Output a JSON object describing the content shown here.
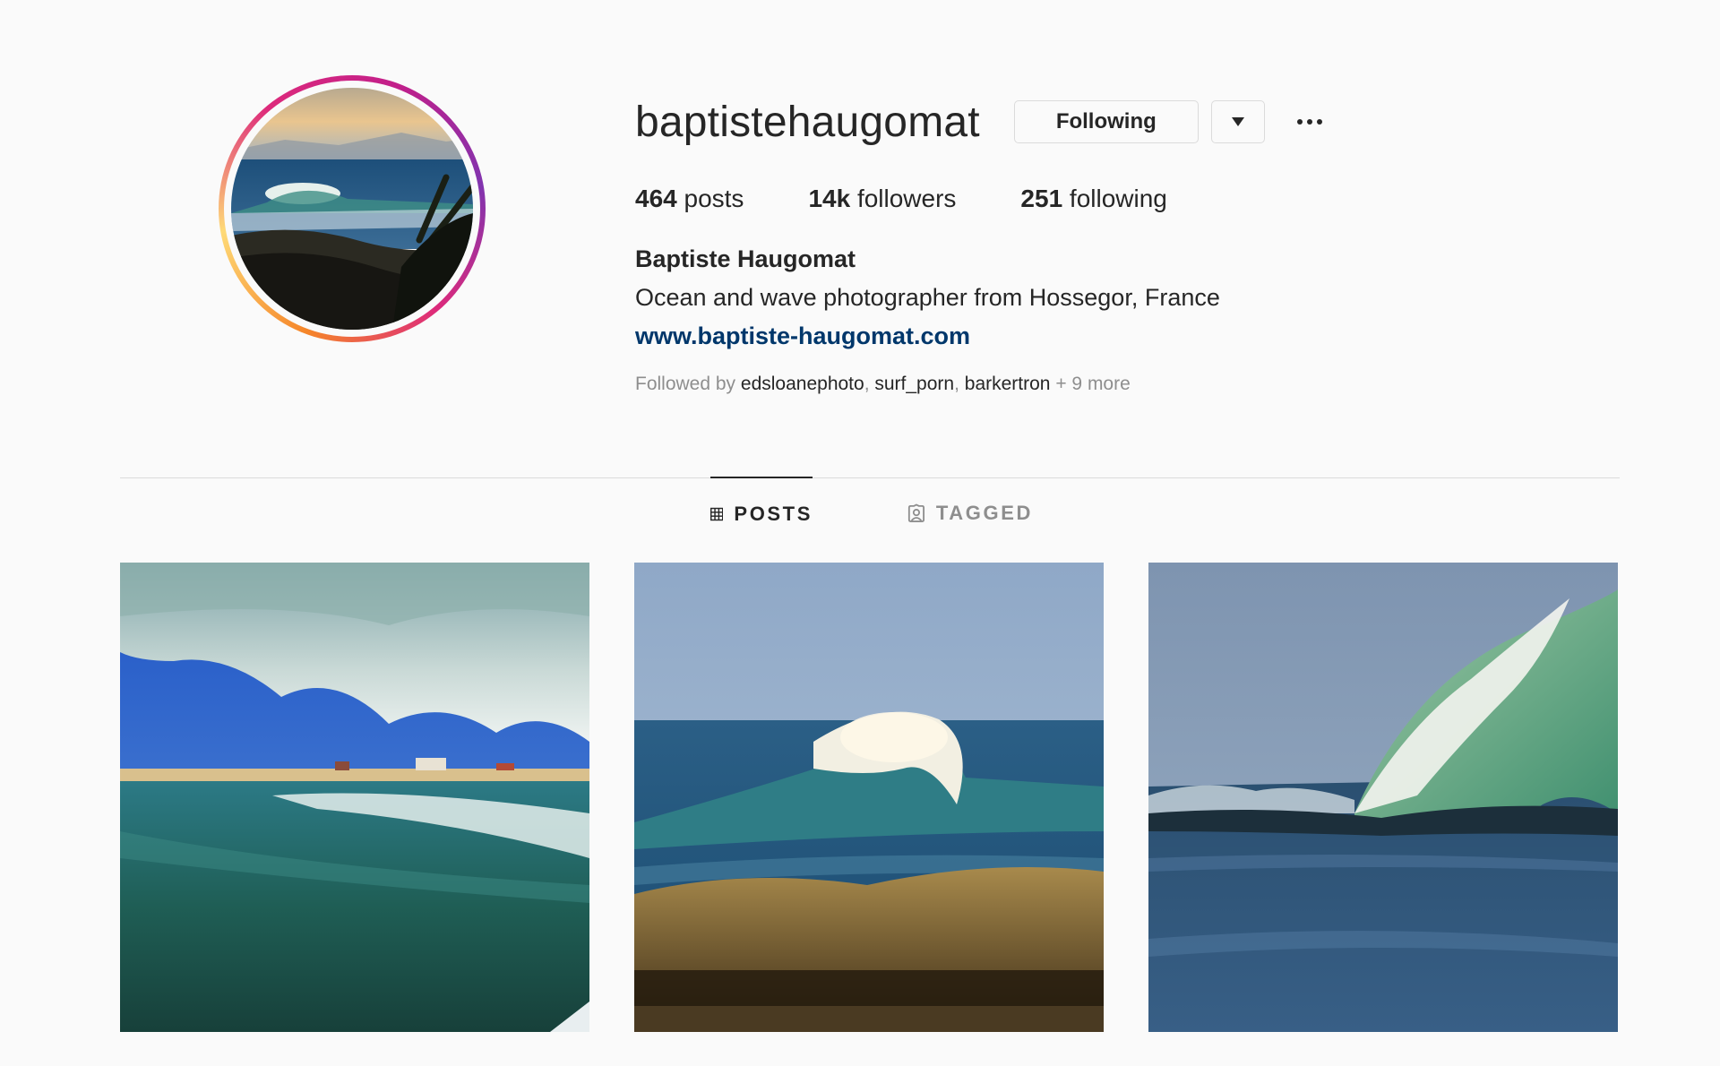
{
  "profile": {
    "username": "baptistehaugomat",
    "following_button": "Following",
    "stats": {
      "posts_count": "464",
      "posts_label": "posts",
      "followers_count": "14k",
      "followers_label": "followers",
      "following_count": "251",
      "following_label": "following"
    },
    "full_name": "Baptiste Haugomat",
    "bio": "Ocean and wave photographer from Hossegor, France",
    "website": "www.baptiste-haugomat.com",
    "followed_by": {
      "prefix": "Followed by",
      "accounts": [
        "edsloanephoto",
        "surf_porn",
        "barkertron"
      ],
      "more": "+ 9 more"
    }
  },
  "tabs": [
    {
      "label": "POSTS",
      "icon": "grid-icon",
      "active": true
    },
    {
      "label": "TAGGED",
      "icon": "tagged-user-icon",
      "active": false
    }
  ],
  "icons": {
    "dropdown": "caret-down-icon",
    "options": "more-options-icon"
  },
  "colors": {
    "background": "#fafafa",
    "text": "#262626",
    "muted": "#8e8e8e",
    "link": "#00376b",
    "border": "#dbdbdb"
  }
}
